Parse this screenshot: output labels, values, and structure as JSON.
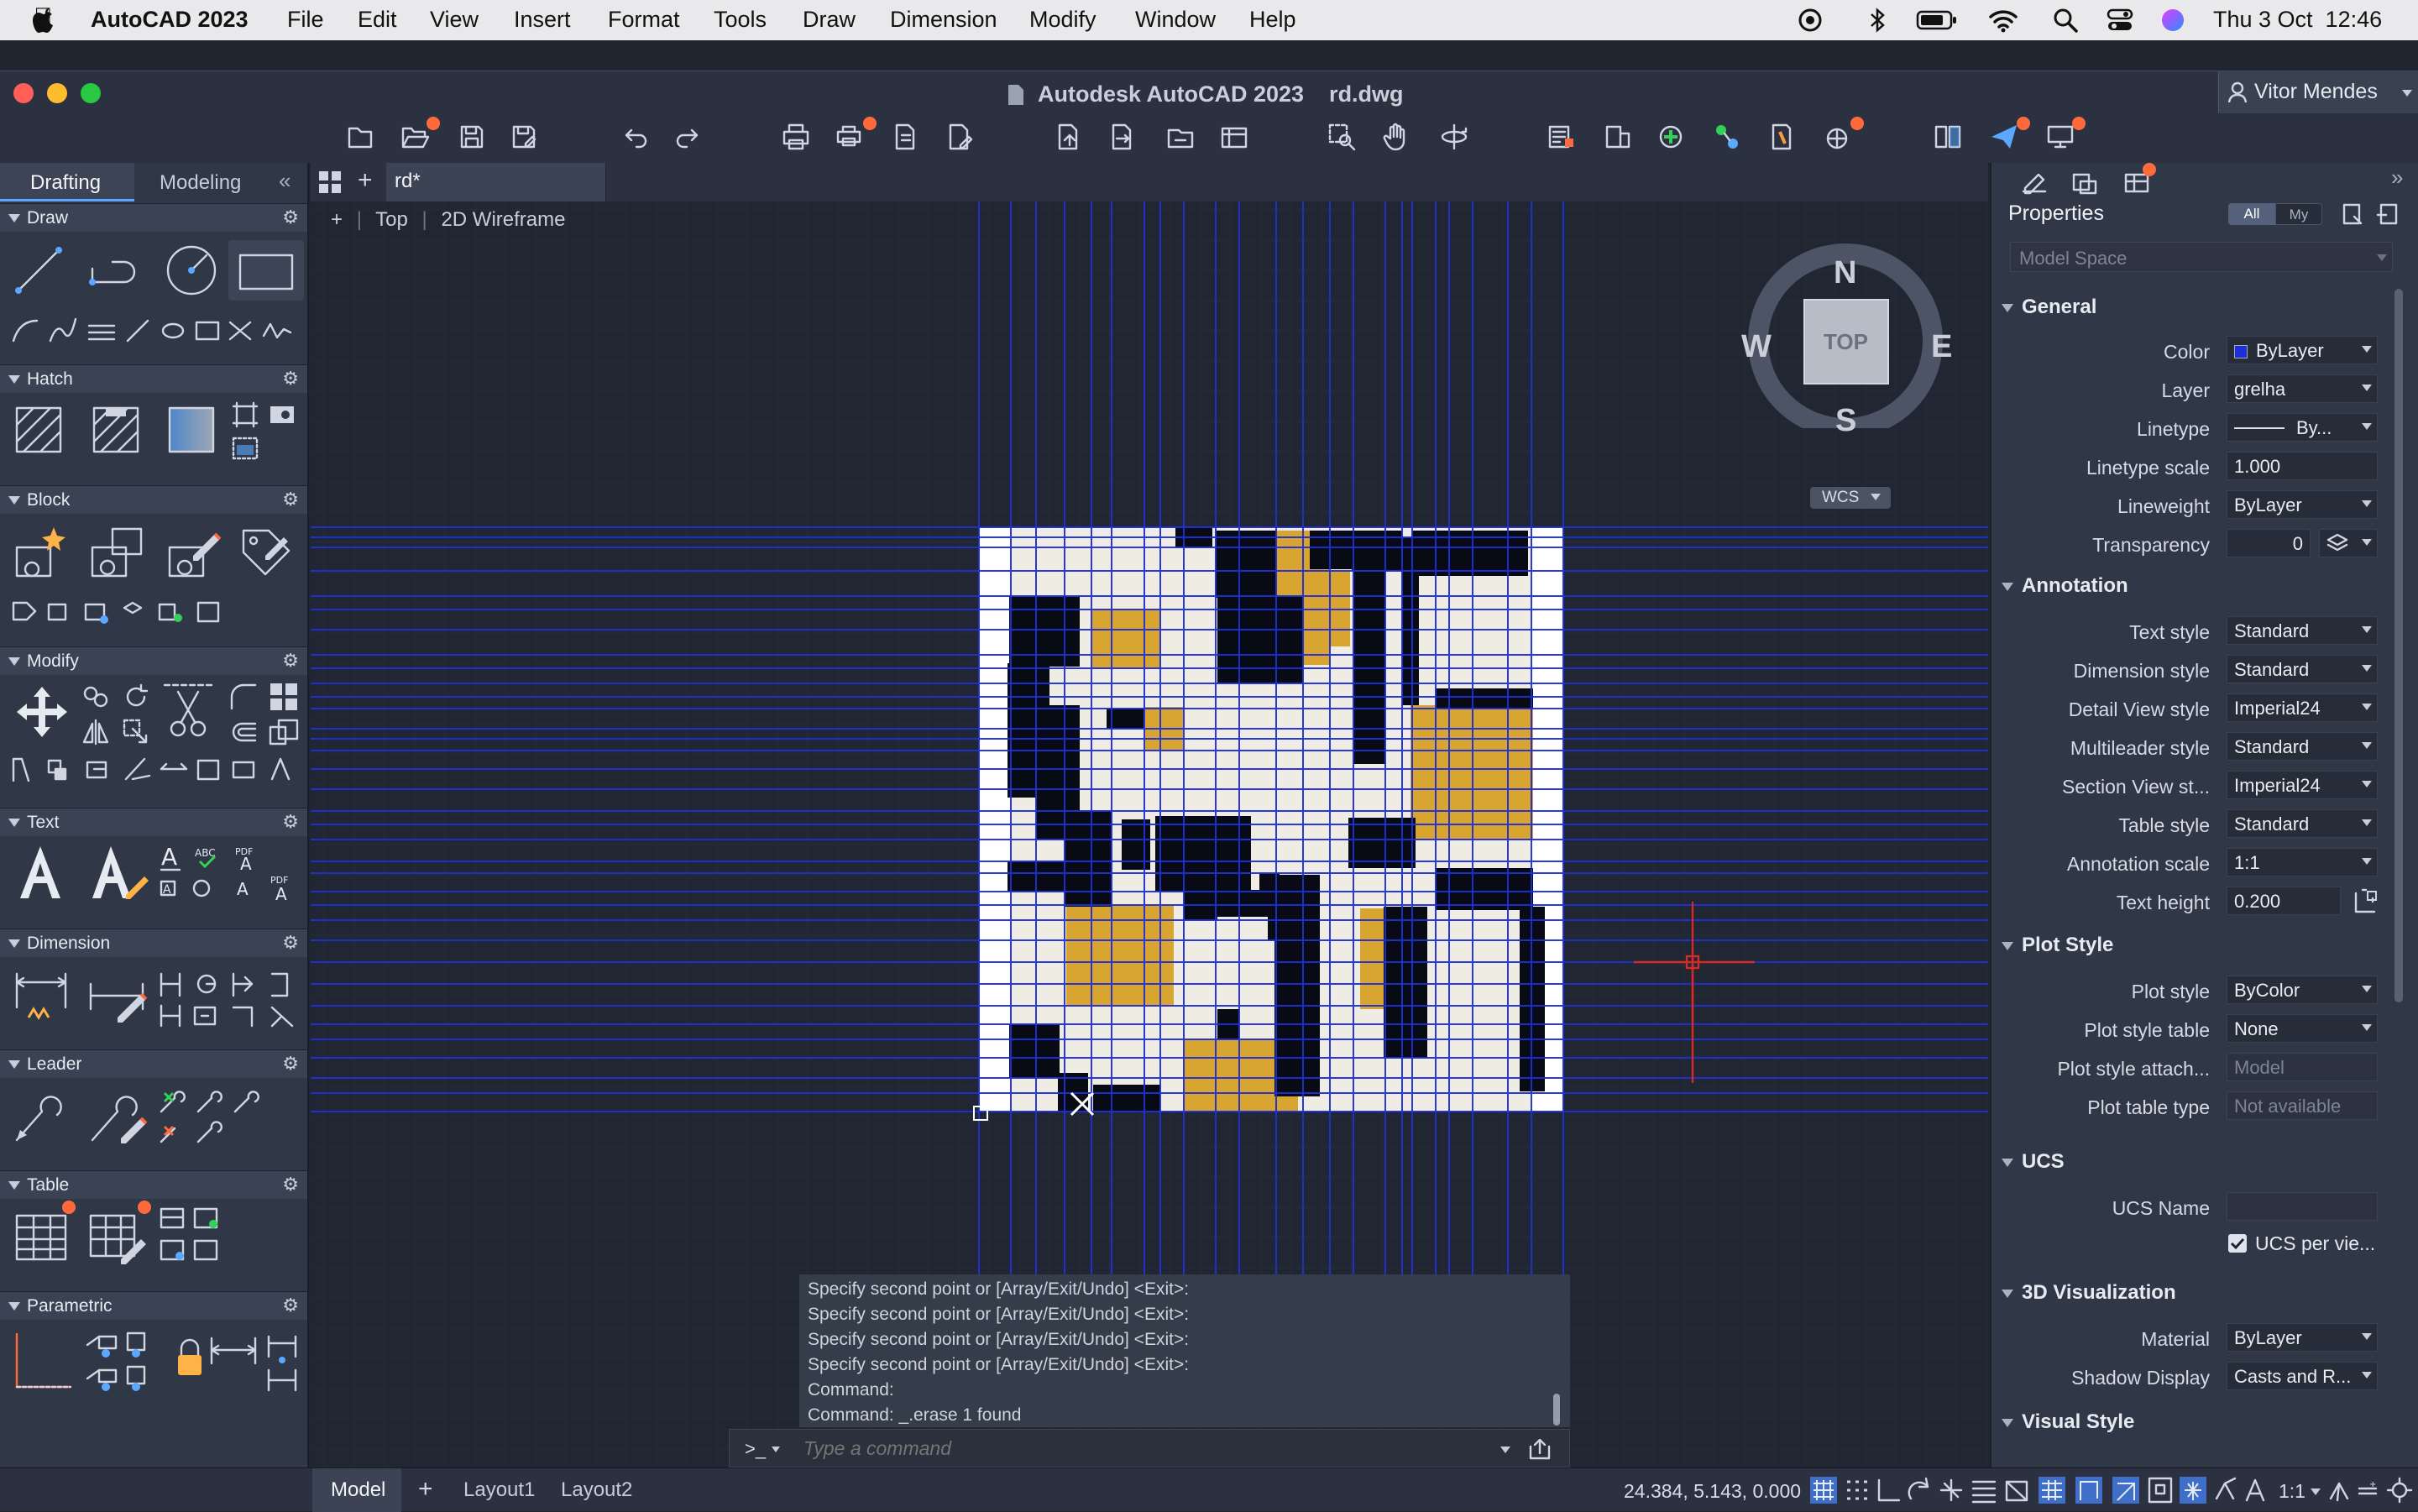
{
  "menubar": {
    "app_name": "AutoCAD 2023",
    "items": [
      "File",
      "Edit",
      "View",
      "Insert",
      "Format",
      "Tools",
      "Draw",
      "Dimension",
      "Modify",
      "Window",
      "Help"
    ],
    "clock": "Thu 3 Oct  12:46"
  },
  "window": {
    "title": "Autodesk AutoCAD 2023    rd.dwg",
    "user": "Vitor Mendes"
  },
  "ribbon_tabs": {
    "drafting": "Drafting",
    "modeling": "Modeling"
  },
  "doc_tab": {
    "name": "rd*"
  },
  "viewport": {
    "plus": "+",
    "view": "Top",
    "style": "2D Wireframe"
  },
  "viewcube": {
    "n": "N",
    "s": "S",
    "e": "E",
    "w": "W",
    "face": "TOP",
    "wcs": "WCS"
  },
  "panels": {
    "draw": "Draw",
    "hatch": "Hatch",
    "block": "Block",
    "modify": "Modify",
    "text": "Text",
    "dimension": "Dimension",
    "leader": "Leader",
    "table": "Table",
    "parametric": "Parametric"
  },
  "properties": {
    "title": "Properties",
    "filter_all": "All",
    "filter_my": "My",
    "space": "Model Space",
    "sections": {
      "general": "General",
      "annotation": "Annotation",
      "plot_style": "Plot Style",
      "ucs": "UCS",
      "viz3d": "3D Visualization",
      "visual_style": "Visual Style"
    },
    "rows": {
      "color": {
        "label": "Color",
        "value": "ByLayer"
      },
      "layer": {
        "label": "Layer",
        "value": "grelha"
      },
      "linetype": {
        "label": "Linetype",
        "value": "By..."
      },
      "linetype_scale": {
        "label": "Linetype scale",
        "value": "1.000"
      },
      "lineweight": {
        "label": "Lineweight",
        "value": "ByLayer"
      },
      "transparency": {
        "label": "Transparency",
        "value": "0"
      },
      "text_style": {
        "label": "Text style",
        "value": "Standard"
      },
      "dim_style": {
        "label": "Dimension style",
        "value": "Standard"
      },
      "detail_view": {
        "label": "Detail View style",
        "value": "Imperial24"
      },
      "mleader": {
        "label": "Multileader style",
        "value": "Standard"
      },
      "section_view": {
        "label": "Section View st...",
        "value": "Imperial24"
      },
      "table_style": {
        "label": "Table style",
        "value": "Standard"
      },
      "anno_scale": {
        "label": "Annotation scale",
        "value": "1:1"
      },
      "text_height": {
        "label": "Text height",
        "value": "0.200"
      },
      "plot_style": {
        "label": "Plot style",
        "value": "ByColor"
      },
      "plot_table": {
        "label": "Plot style table",
        "value": "None"
      },
      "plot_attach": {
        "label": "Plot style attach...",
        "value": "Model"
      },
      "plot_type": {
        "label": "Plot table type",
        "value": "Not available"
      },
      "ucs_name": {
        "label": "UCS Name",
        "value": ""
      },
      "ucs_per_view": {
        "label": "UCS per vie..."
      },
      "material": {
        "label": "Material",
        "value": "ByLayer"
      },
      "shadow": {
        "label": "Shadow Display",
        "value": "Casts and R..."
      }
    }
  },
  "command": {
    "history": [
      "Specify second point or [Array/Exit/Undo] <Exit>:",
      "Specify second point or [Array/Exit/Undo] <Exit>:",
      "Specify second point or [Array/Exit/Undo] <Exit>:",
      "Specify second point or [Array/Exit/Undo] <Exit>:",
      "Command:",
      "Command: _.erase 1 found"
    ],
    "prompt_icon": ">_",
    "placeholder": "Type a command"
  },
  "status": {
    "tabs": [
      "Model",
      "Layout1",
      "Layout2"
    ],
    "add": "+",
    "coords": "24.384, 5.143, 0.000",
    "scale": "1:1"
  },
  "colors": {
    "accent": "#ff6a3d",
    "grid_blue": "#1f2fd6",
    "ochre": "#d9a531",
    "paper": "#efece3"
  }
}
